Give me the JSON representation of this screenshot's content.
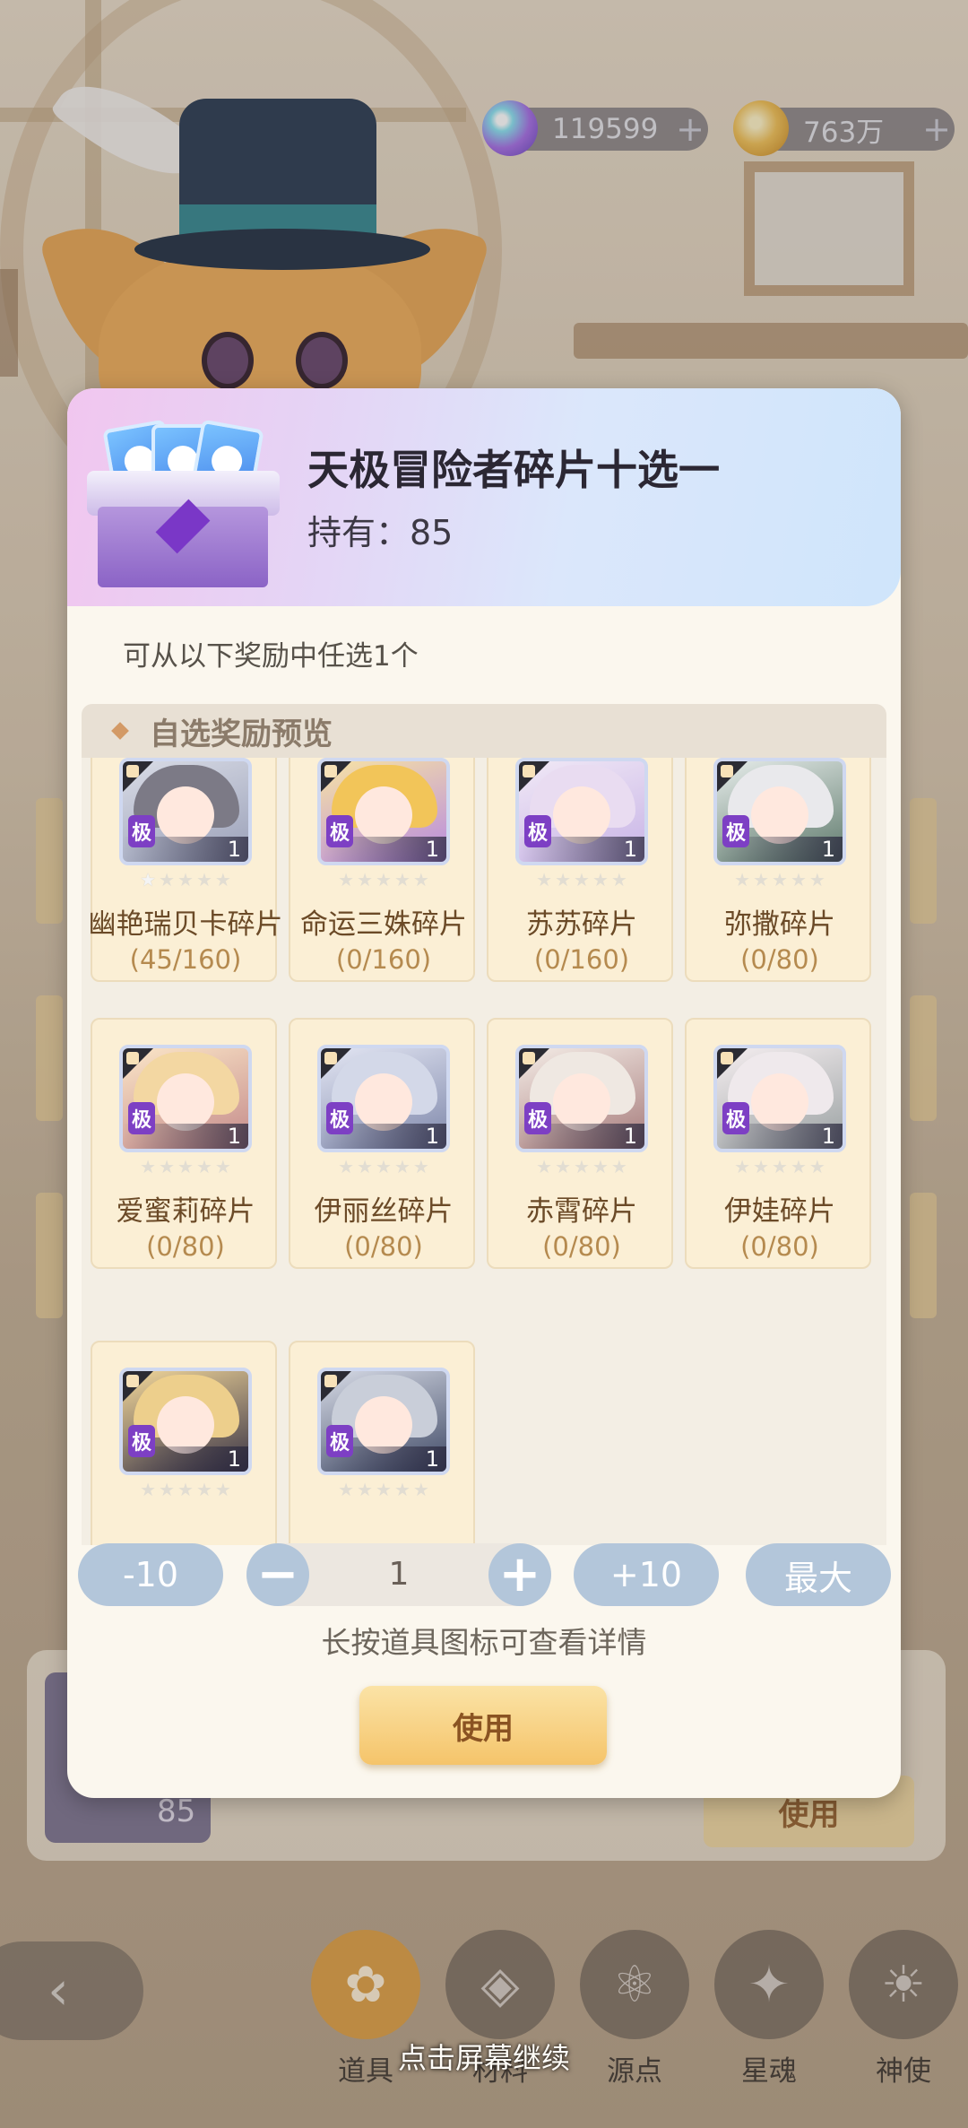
{
  "currency": {
    "gems": {
      "icon": "gem-icon",
      "value": "119599",
      "plus": "+"
    },
    "coins": {
      "icon": "paw-coin-icon",
      "value": "763万",
      "plus": "+"
    }
  },
  "modal": {
    "title": "天极冒险者碎片十选一",
    "owned": "持有：85",
    "description": "可从以下奖励中任选1个",
    "section_title": "自选奖励预览",
    "rewards": [
      {
        "name": "幽艳瑞贝卡碎片",
        "progress": "(45/160)",
        "tier": "极",
        "qty": "1",
        "stars_lit": 1
      },
      {
        "name": "命运三姝碎片",
        "progress": "(0/160)",
        "tier": "极",
        "qty": "1",
        "stars_lit": 0
      },
      {
        "name": "苏苏碎片",
        "progress": "(0/160)",
        "tier": "极",
        "qty": "1",
        "stars_lit": 0
      },
      {
        "name": "弥撒碎片",
        "progress": "(0/80)",
        "tier": "极",
        "qty": "1",
        "stars_lit": 0
      },
      {
        "name": "爱蜜莉碎片",
        "progress": "(0/80)",
        "tier": "极",
        "qty": "1",
        "stars_lit": 0
      },
      {
        "name": "伊丽丝碎片",
        "progress": "(0/80)",
        "tier": "极",
        "qty": "1",
        "stars_lit": 0
      },
      {
        "name": "赤霄碎片",
        "progress": "(0/80)",
        "tier": "极",
        "qty": "1",
        "stars_lit": 0
      },
      {
        "name": "伊娃碎片",
        "progress": "(0/80)",
        "tier": "极",
        "qty": "1",
        "stars_lit": 0
      },
      {
        "name": "",
        "progress": "",
        "tier": "极",
        "qty": "1",
        "stars_lit": 0
      },
      {
        "name": "",
        "progress": "",
        "tier": "极",
        "qty": "1",
        "stars_lit": 0
      }
    ],
    "controls": {
      "minus10": "-10",
      "minus": "−",
      "value": "1",
      "plus": "+",
      "plus10": "+10",
      "max": "最大"
    },
    "hint": "长按道具图标可查看详情",
    "use_label": "使用"
  },
  "background": {
    "item_count": "85",
    "use_label": "使用"
  },
  "nav": {
    "back": "‹",
    "tabs": [
      {
        "label": "道具",
        "icon": "bag-icon"
      },
      {
        "label": "材料",
        "icon": "dice-icon"
      },
      {
        "label": "源点",
        "icon": "atom-icon"
      },
      {
        "label": "星魂",
        "icon": "star-card-icon"
      },
      {
        "label": "神使",
        "icon": "sun-icon"
      }
    ]
  },
  "continue_hint": "点击屏幕继续"
}
